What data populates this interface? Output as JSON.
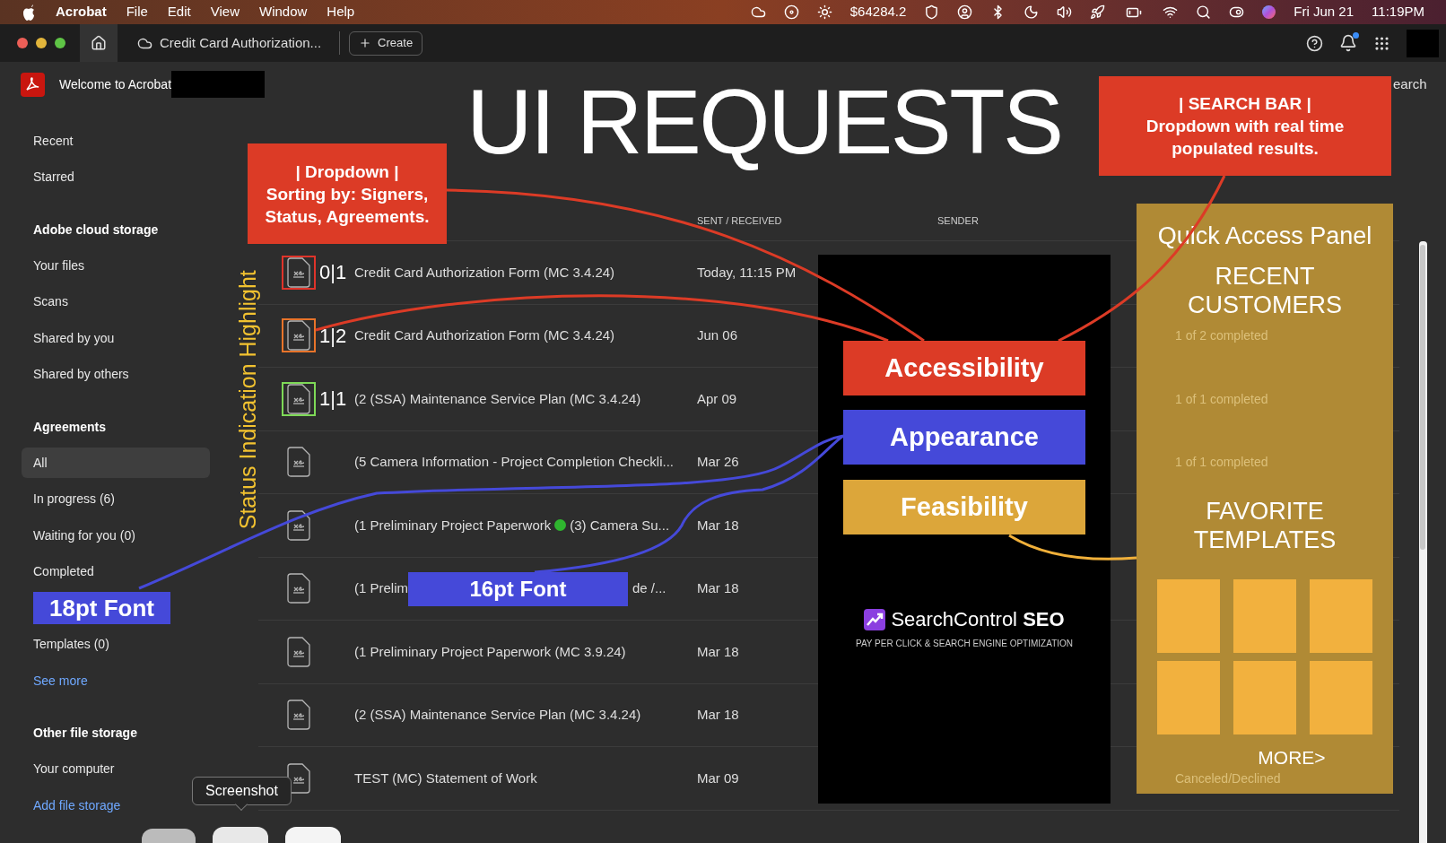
{
  "menu_bar": {
    "app": "Acrobat",
    "menus": [
      "File",
      "Edit",
      "View",
      "Window",
      "Help"
    ],
    "balance": "$64284.2",
    "date": "Fri Jun 21",
    "time": "11:19PM"
  },
  "tab_bar": {
    "tabs": [
      {
        "kind": "home",
        "selected": true
      },
      {
        "kind": "document",
        "label": "Credit Card Authorization...",
        "selected": false
      }
    ],
    "create_button": "Create",
    "notifications_unread": true
  },
  "header": {
    "welcome": "Welcome to Acrobat",
    "search_label": "earch"
  },
  "sidebar": {
    "sections": [
      {
        "items": [
          {
            "kind": "item",
            "label": "Recent",
            "selected": false
          },
          {
            "kind": "item",
            "label": "Starred",
            "selected": false
          }
        ]
      },
      {
        "heading": "Adobe cloud storage",
        "items": [
          {
            "kind": "item",
            "label": "Your files",
            "selected": false
          },
          {
            "kind": "item",
            "label": "Scans",
            "selected": false
          },
          {
            "kind": "item",
            "label": "Shared by you",
            "selected": false
          },
          {
            "kind": "item",
            "label": "Shared by others",
            "selected": false
          }
        ]
      },
      {
        "heading": "Agreements",
        "items": [
          {
            "kind": "item",
            "label": "All",
            "selected": true
          },
          {
            "kind": "item",
            "label": "In progress (6)",
            "selected": false
          },
          {
            "kind": "item",
            "label": "Waiting for you (0)",
            "selected": false
          },
          {
            "kind": "item",
            "label": "Completed",
            "selected": false
          },
          {
            "kind": "annotation",
            "label": "18pt Font"
          },
          {
            "kind": "item",
            "label": "Templates (0)",
            "selected": false
          },
          {
            "kind": "link",
            "label": "See more"
          }
        ]
      },
      {
        "heading": "Other file storage",
        "items": [
          {
            "kind": "item",
            "label": "Your computer",
            "selected": false
          },
          {
            "kind": "link",
            "label": "Add file storage"
          }
        ]
      }
    ]
  },
  "table": {
    "columns": [
      "SENT / RECEIVED",
      "SENDER"
    ],
    "rows": [
      {
        "kind": "plain",
        "color": "#e0342a",
        "count": "0|1",
        "name": "Credit Card Authorization Form (MC 3.4.24)",
        "date": "Today, 11:15 PM"
      },
      {
        "kind": "plain",
        "color": "#e8742a",
        "count": "1|2",
        "name": "Credit Card Authorization Form (MC 3.4.24)",
        "date": "Jun 06",
        "status": "1 of 2 completed"
      },
      {
        "kind": "plain",
        "color": "#7ed957",
        "count": "1|1",
        "name": "(2 (SSA) Maintenance Service Plan (MC 3.4.24)",
        "date": "Apr 09",
        "status": "1 of 1 completed"
      },
      {
        "kind": "plain",
        "name": "(5 Camera Information - Project Completion Checkli...",
        "date": "Mar 26",
        "status": "1 of 1 completed"
      },
      {
        "kind": "dot",
        "name": "(1 Preliminary Project Paperwork",
        "dot": {
          "color": "#2fb52f"
        },
        "name_tail": "(3) Camera Su...",
        "date": "Mar 18"
      },
      {
        "kind": "covered",
        "name": "(1 Prelim",
        "name_tail": "de /...",
        "date": "Mar 18"
      },
      {
        "kind": "plain",
        "name": "(1 Preliminary Project Paperwork (MC 3.9.24)",
        "date": "Mar 18"
      },
      {
        "kind": "plain",
        "name": "(2 (SSA) Maintenance Service Plan (MC 3.4.24)",
        "date": "Mar 18"
      },
      {
        "kind": "plain",
        "name": "TEST (MC) Statement of Work",
        "date": "Mar 09",
        "status": "Canceled/Declined"
      }
    ]
  },
  "annotations": {
    "title": "UI REQUESTS",
    "callouts": [
      {
        "kind": "dropdown",
        "text": "| Dropdown |\nSorting by: Signers,\nStatus, Agreements."
      },
      {
        "kind": "search",
        "text": "| SEARCH BAR |\nDropdown with real time\npopulated results."
      }
    ],
    "vertical_label": "Status Indication Highlight",
    "categories": [
      {
        "label": "Accessibility",
        "color": "#dc3b26"
      },
      {
        "label": "Appearance",
        "color": "#4549d9"
      },
      {
        "label": "Feasibility",
        "color": "#dca63a"
      }
    ],
    "table_font_label": "16pt Font",
    "quick_access": {
      "title": "Quick Access Panel",
      "sections": [
        "RECENT\nCUSTOMERS",
        "FAVORITE\nTEMPLATES"
      ],
      "more": "MORE>"
    },
    "ad": {
      "brand": "SearchControl",
      "brand_bold": "SEO",
      "tagline": "PAY PER CLICK & SEARCH ENGINE OPTIMIZATION"
    },
    "tooltip": "Screenshot"
  }
}
